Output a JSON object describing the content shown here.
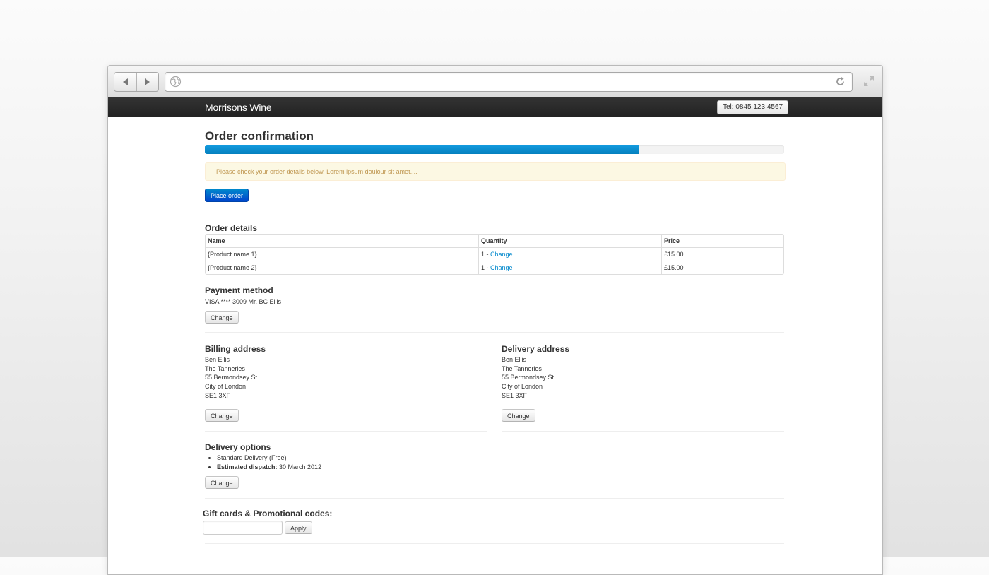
{
  "browser": {
    "url": ""
  },
  "topbar": {
    "brand": "Morrisons Wine",
    "tel": "Tel: 0845 123 4567"
  },
  "page": {
    "title": "Order confirmation",
    "progress_percent": 75,
    "alert": "Please check your order details below. Lorem ipsum doulour sit amet....",
    "place_order": "Place order"
  },
  "order_details": {
    "heading": "Order details",
    "columns": [
      "Name",
      "Quantity",
      "Price"
    ],
    "rows": [
      {
        "name": "{Product name 1}",
        "qty": "1 - ",
        "change": "Change",
        "price": "£15.00"
      },
      {
        "name": "{Product name 2}",
        "qty": "1 - ",
        "change": "Change",
        "price": "£15.00"
      }
    ]
  },
  "payment": {
    "heading": "Payment method",
    "text": "VISA **** 3009 Mr. BC Ellis",
    "change": "Change"
  },
  "billing": {
    "heading": "Billing address",
    "lines": [
      "Ben Ellis",
      "The Tanneries",
      "55 Bermondsey St",
      "City of London",
      "SE1 3XF"
    ],
    "change": "Change"
  },
  "delivery_address": {
    "heading": "Delivery address",
    "lines": [
      "Ben Ellis",
      "The Tanneries",
      "55 Bermondsey St",
      "City of London",
      "SE1 3XF"
    ],
    "change": "Change"
  },
  "delivery_options": {
    "heading": "Delivery options",
    "item1": "Standard Delivery (Free)",
    "item2_label": "Estimated dispatch:",
    "item2_value": " 30 March 2012",
    "change": "Change"
  },
  "gift": {
    "heading": "Gift cards & Promotional codes:",
    "input_value": "",
    "apply": "Apply"
  },
  "colors": {
    "accent": "#0088cc",
    "progress": "#149bdf",
    "alert_bg": "#fcf8e3",
    "alert_text": "#c09853",
    "topbar": "#222222"
  }
}
